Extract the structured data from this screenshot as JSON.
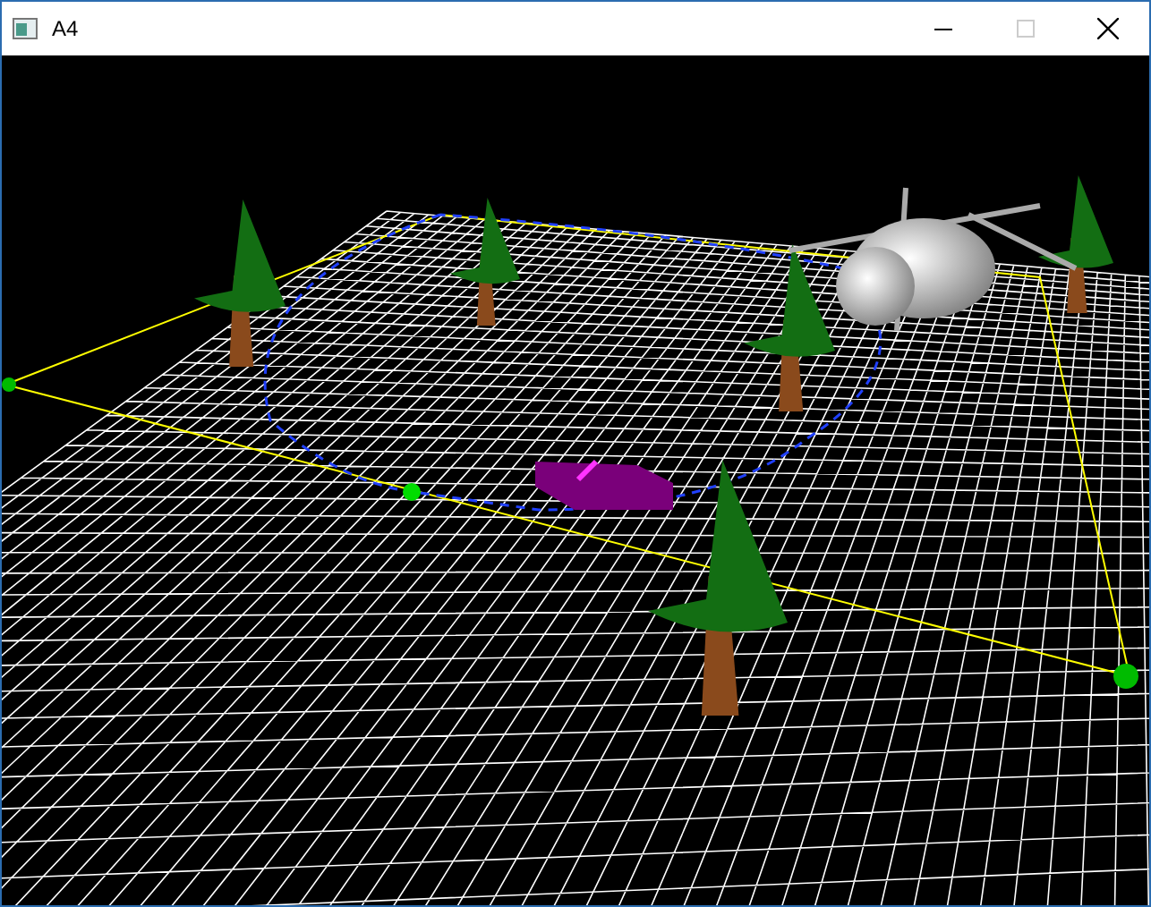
{
  "window": {
    "title": "A4",
    "maximize_disabled": true
  }
}
